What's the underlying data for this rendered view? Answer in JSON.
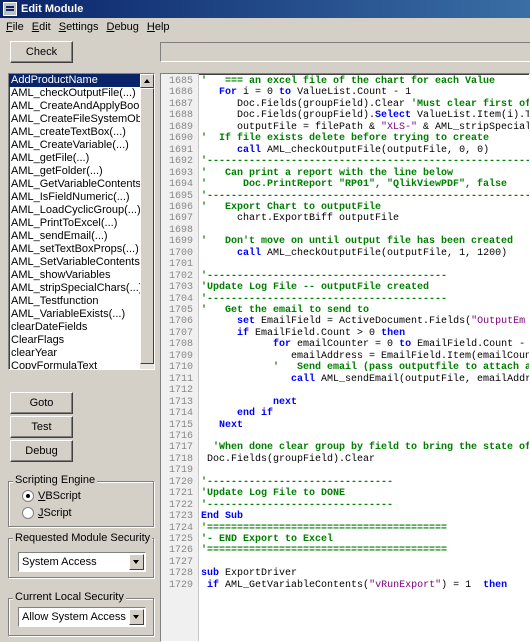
{
  "window": {
    "title": "Edit Module"
  },
  "menu": [
    "File",
    "Edit",
    "Settings",
    "Debug",
    "Help"
  ],
  "buttons": {
    "check": "Check",
    "goto": "Goto",
    "test": "Test",
    "debug": "Debug"
  },
  "function_list": {
    "items": [
      "AddProductName",
      "AML_checkOutputFile(...)",
      "AML_CreateAndApplyBookma",
      "AML_CreateFileSystemObject",
      "AML_createTextBox(...)",
      "AML_CreateVariable(...)",
      "AML_getFile(...)",
      "AML_getFolder(...)",
      "AML_GetVariableContents(...)",
      "AML_IsFieldNumeric(...)",
      "AML_LoadCyclicGroup(...)",
      "AML_PrintToExcel(...)",
      "AML_sendEmail(...)",
      "AML_setTextBoxProps(...)",
      "AML_SetVariableContents(...)",
      "AML_showVariables",
      "AML_stripSpecialChars(...)",
      "AML_Testfunction",
      "AML_VariableExists(...)",
      "clearDateFields",
      "ClearFlags",
      "clearYear",
      "CopyFormulaText"
    ],
    "selected_index": 0
  },
  "scripting_engine": {
    "label": "Scripting Engine",
    "options": [
      "VBScript",
      "JScript"
    ],
    "selected": "VBScript"
  },
  "module_security": {
    "label": "Requested Module Security",
    "value": "System Access"
  },
  "local_security": {
    "label": "Current Local Security",
    "value": "Allow System Access"
  },
  "colors": {
    "keyword": "#0000ff",
    "comment": "#008000",
    "string": "#800080",
    "selection": "#0a246a"
  },
  "editor": {
    "lines": [
      {
        "n": "1685",
        "tokens": [
          [
            "c",
            "'   === an excel file of the chart for each Value          ("
          ]
        ]
      },
      {
        "n": "1686",
        "tokens": [
          [
            "p",
            "   "
          ],
          [
            "k",
            "For"
          ],
          [
            "p",
            " i = 0 "
          ],
          [
            "k",
            "to"
          ],
          [
            "p",
            " ValueList.Count - 1"
          ]
        ]
      },
      {
        "n": "1687",
        "tokens": [
          [
            "p",
            "      Doc.Fields(groupField).Clear "
          ],
          [
            "c",
            "'Must clear first of"
          ]
        ]
      },
      {
        "n": "1688",
        "tokens": [
          [
            "p",
            "      Doc.Fields(groupField)."
          ],
          [
            "k",
            "Select"
          ],
          [
            "p",
            " ValueList.Item(i).T"
          ]
        ]
      },
      {
        "n": "1689",
        "tokens": [
          [
            "p",
            "      outputFile = filePath & "
          ],
          [
            "s",
            "\"XLS-\""
          ],
          [
            "p",
            " & AML_stripSpecial"
          ]
        ]
      },
      {
        "n": "1690",
        "tokens": [
          [
            "c",
            "'  If file exists delete before trying to create"
          ]
        ]
      },
      {
        "n": "1691",
        "tokens": [
          [
            "p",
            "      "
          ],
          [
            "k",
            "call"
          ],
          [
            "p",
            " AML_checkOutputFile(outputFile, 0, 0)"
          ]
        ]
      },
      {
        "n": "1692",
        "tokens": [
          [
            "c",
            "'-------------------------------------------------------"
          ]
        ]
      },
      {
        "n": "1693",
        "tokens": [
          [
            "c",
            "'   Can print a report with the line below"
          ]
        ]
      },
      {
        "n": "1694",
        "tokens": [
          [
            "c",
            "'      Doc.PrintReport \"RP01\", \"QlikViewPDF\", false"
          ]
        ]
      },
      {
        "n": "1695",
        "tokens": [
          [
            "c",
            "'-------------------------------------------------------"
          ]
        ]
      },
      {
        "n": "1696",
        "tokens": [
          [
            "c",
            "'   Export Chart to outputFile"
          ]
        ]
      },
      {
        "n": "1697",
        "tokens": [
          [
            "p",
            "      chart.ExportBiff outputFile"
          ]
        ]
      },
      {
        "n": "1698",
        "tokens": [
          [
            "p",
            ""
          ]
        ]
      },
      {
        "n": "1699",
        "tokens": [
          [
            "c",
            "'   Don't move on until output file has been created"
          ]
        ]
      },
      {
        "n": "1700",
        "tokens": [
          [
            "p",
            "      "
          ],
          [
            "k",
            "call"
          ],
          [
            "p",
            " AML_checkOutputFile(outputFile, 1, 1200)"
          ]
        ]
      },
      {
        "n": "1701",
        "tokens": [
          [
            "p",
            ""
          ]
        ]
      },
      {
        "n": "1702",
        "tokens": [
          [
            "c",
            "'----------------------------------------"
          ]
        ]
      },
      {
        "n": "1703",
        "tokens": [
          [
            "c",
            "'Update Log File -- outputFile created"
          ]
        ]
      },
      {
        "n": "1704",
        "tokens": [
          [
            "c",
            "'----------------------------------------"
          ]
        ]
      },
      {
        "n": "1705",
        "tokens": [
          [
            "c",
            "'   Get the email to send to"
          ]
        ]
      },
      {
        "n": "1706",
        "tokens": [
          [
            "p",
            "      "
          ],
          [
            "k",
            "set"
          ],
          [
            "p",
            " EmailField = ActiveDocument.Fields("
          ],
          [
            "s",
            "\"OutputEm"
          ]
        ]
      },
      {
        "n": "1707",
        "tokens": [
          [
            "p",
            "      "
          ],
          [
            "k",
            "if"
          ],
          [
            "p",
            " EmailField.Count > 0 "
          ],
          [
            "k",
            "then"
          ]
        ]
      },
      {
        "n": "1708",
        "tokens": [
          [
            "p",
            "            "
          ],
          [
            "k",
            "for"
          ],
          [
            "p",
            " emailCounter = 0 "
          ],
          [
            "k",
            "to"
          ],
          [
            "p",
            " EmailField.Count -"
          ]
        ]
      },
      {
        "n": "1709",
        "tokens": [
          [
            "p",
            "               emailAddress = EmailField.Item(emailCoun"
          ]
        ]
      },
      {
        "n": "1710",
        "tokens": [
          [
            "p",
            "            "
          ],
          [
            "c",
            "'   Send email (pass outputfile to attach and"
          ]
        ]
      },
      {
        "n": "1711",
        "tokens": [
          [
            "p",
            "               "
          ],
          [
            "k",
            "call"
          ],
          [
            "p",
            " AML_sendEmail(outputFile, emailAddr"
          ]
        ]
      },
      {
        "n": "1712",
        "tokens": [
          [
            "p",
            ""
          ]
        ]
      },
      {
        "n": "1713",
        "tokens": [
          [
            "p",
            "            "
          ],
          [
            "k",
            "next"
          ]
        ]
      },
      {
        "n": "1714",
        "tokens": [
          [
            "p",
            "      "
          ],
          [
            "k",
            "end if"
          ]
        ]
      },
      {
        "n": "1715",
        "tokens": [
          [
            "p",
            "   "
          ],
          [
            "k",
            "Next"
          ]
        ]
      },
      {
        "n": "1716",
        "tokens": [
          [
            "p",
            ""
          ]
        ]
      },
      {
        "n": "1717",
        "tokens": [
          [
            "c",
            "  'When done clear group by field to bring the state of c"
          ]
        ]
      },
      {
        "n": "1718",
        "tokens": [
          [
            "p",
            " Doc.Fields(groupField).Clear"
          ]
        ]
      },
      {
        "n": "1719",
        "tokens": [
          [
            "p",
            ""
          ]
        ]
      },
      {
        "n": "1720",
        "tokens": [
          [
            "c",
            "'-------------------------------"
          ]
        ]
      },
      {
        "n": "1721",
        "tokens": [
          [
            "c",
            "'Update Log File to DONE"
          ]
        ]
      },
      {
        "n": "1722",
        "tokens": [
          [
            "c",
            "'-------------------------------"
          ]
        ]
      },
      {
        "n": "1723",
        "tokens": [
          [
            "k",
            "End Sub"
          ]
        ]
      },
      {
        "n": "1724",
        "tokens": [
          [
            "c",
            "'========================================"
          ]
        ]
      },
      {
        "n": "1725",
        "tokens": [
          [
            "c",
            "'- END Export to Excel"
          ]
        ]
      },
      {
        "n": "1726",
        "tokens": [
          [
            "c",
            "'========================================"
          ]
        ]
      },
      {
        "n": "1727",
        "tokens": [
          [
            "p",
            ""
          ]
        ]
      },
      {
        "n": "1728",
        "tokens": [
          [
            "k",
            "sub"
          ],
          [
            "p",
            " ExportDriver"
          ]
        ]
      },
      {
        "n": "1729",
        "tokens": [
          [
            "p",
            " "
          ],
          [
            "k",
            "if"
          ],
          [
            "p",
            " AML_GetVariableContents("
          ],
          [
            "s",
            "\"vRunExport\""
          ],
          [
            "p",
            ") = 1  "
          ],
          [
            "k",
            "then"
          ]
        ]
      }
    ]
  }
}
